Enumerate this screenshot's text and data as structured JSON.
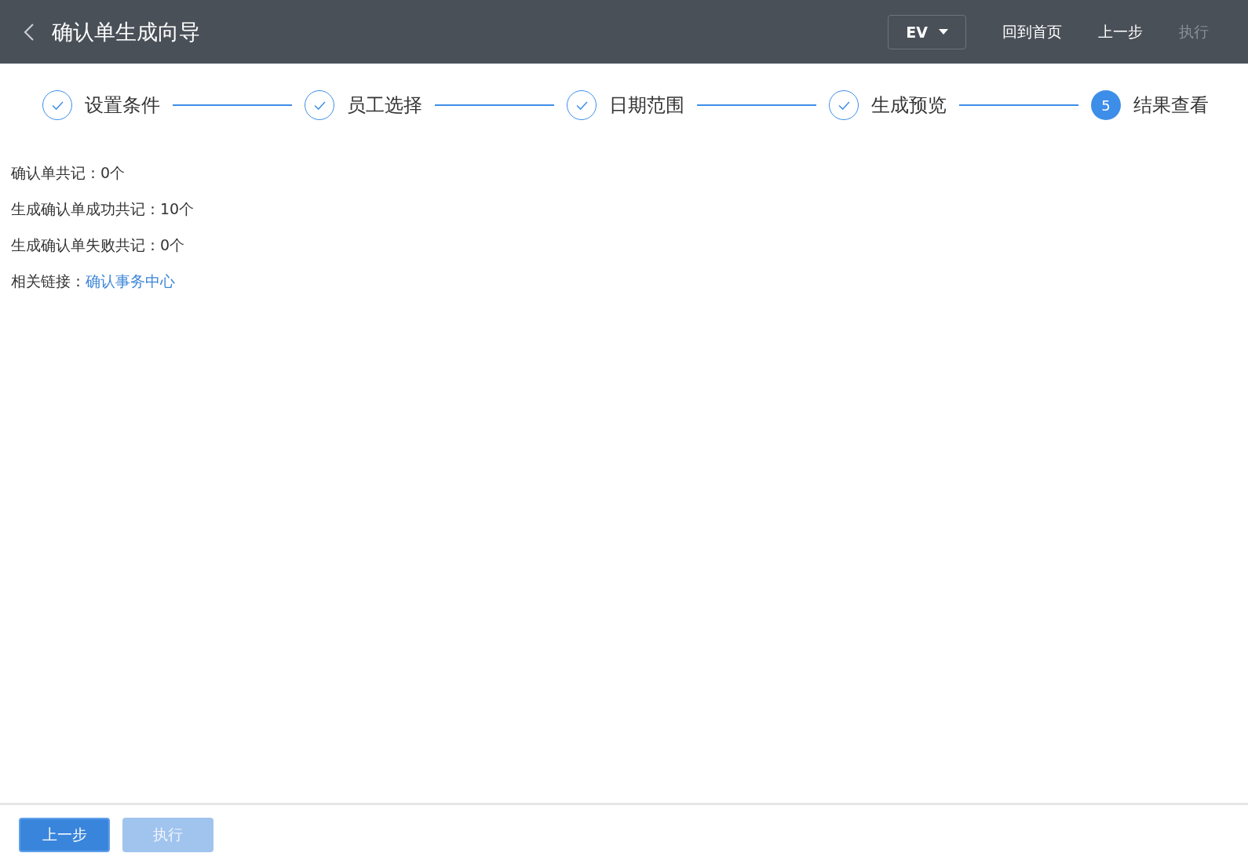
{
  "header": {
    "title": "确认单生成向导",
    "language": "EV",
    "actions": [
      {
        "label": "回到首页",
        "disabled": false
      },
      {
        "label": "上一步",
        "disabled": false
      },
      {
        "label": "执行",
        "disabled": true
      }
    ]
  },
  "steps": [
    {
      "label": "设置条件",
      "completed": true
    },
    {
      "label": "员工选择",
      "completed": true
    },
    {
      "label": "日期范围",
      "completed": true
    },
    {
      "label": "生成预览",
      "completed": true
    },
    {
      "label": "结果查看",
      "completed": false,
      "number": "5"
    }
  ],
  "summary": [
    {
      "kind": "text",
      "text": "确认单共记：0个"
    },
    {
      "kind": "text",
      "text": "生成确认单成功共记：10个"
    },
    {
      "kind": "text",
      "text": "生成确认单失败共记：0个"
    },
    {
      "kind": "link",
      "label": "相关链接：",
      "link": "确认事务中心"
    }
  ],
  "footer": {
    "buttons": [
      {
        "label": "上一步",
        "disabled": false
      },
      {
        "label": "执行",
        "disabled": true
      }
    ]
  }
}
